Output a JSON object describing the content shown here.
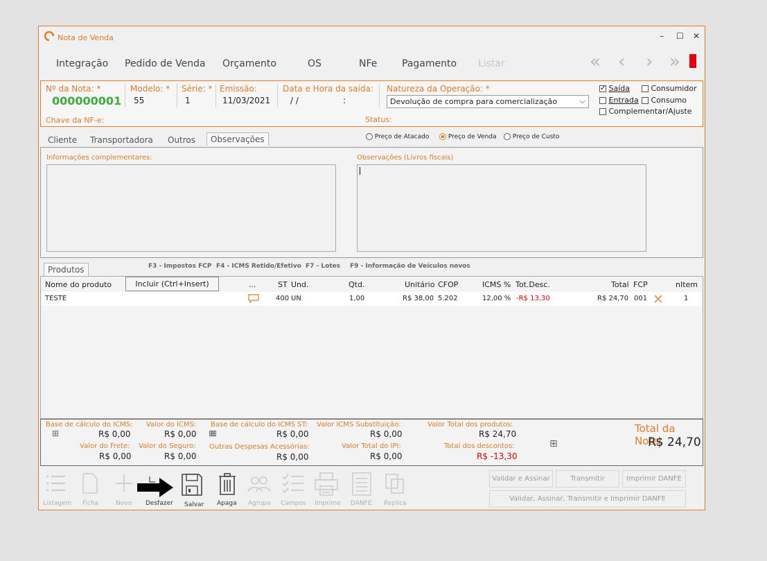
{
  "window": {
    "title": "Nota de Venda",
    "controls": [
      "–",
      "☐",
      "✕"
    ]
  },
  "menu": {
    "items": [
      "Integração",
      "Pedido de Venda",
      "Orçamento",
      "OS",
      "NFe",
      "Pagamento"
    ],
    "disabled_item": "Listar"
  },
  "nav": {
    "first": "«",
    "prev": "‹",
    "next": "›",
    "last": "»"
  },
  "header": {
    "nota_label": "Nº da Nota: *",
    "nota_value": "000000001",
    "modelo_label": "Modelo: *",
    "modelo_value": "55",
    "serie_label": "Série: *",
    "serie_value": "1",
    "emissao_label": "Emissão:",
    "emissao_value": "11/03/2021",
    "saida_label": "Data e Hora da saída:",
    "saida_value": "/  /",
    "saida_time": ":",
    "natureza_label": "Natureza da Operação: *",
    "natureza_value": "Devolução de compra para comercialização",
    "chave_label": "Chave da NF-e:",
    "status_label": "Status:",
    "checkboxes": {
      "saida": "Saída",
      "entrada": "Entrada",
      "complementar": "Complementar/Ajuste",
      "consumidor": "Consumidor",
      "consumo": "Consumo"
    }
  },
  "tabs": [
    "Cliente",
    "Transportadora",
    "Outros",
    "Observações"
  ],
  "price_options": [
    "Preço de Atacado",
    "Preço de Venda",
    "Preço de Custo"
  ],
  "observacoes": {
    "info_label": "Informações complementares:",
    "obs_label": "Observações (Livros fiscais)"
  },
  "produtos": {
    "tab": "Produtos",
    "fkeys": [
      "F3 - Impostos FCP",
      "F4 - ICMS Retido/Efetivo",
      "F7 - Lotes",
      "F9 - Informação de Veículos novos"
    ],
    "incluir": "Incluir (Ctrl+Insert)",
    "columns": {
      "nome": "Nome do produto",
      "dots": "...",
      "st": "ST",
      "und": "Und.",
      "qtd": "Qtd.",
      "unitario": "Unitário",
      "cfop": "CFOP",
      "icms": "ICMS %",
      "totdesc": "Tot.Desc.",
      "total": "Total",
      "fcp": "FCP",
      "nitem": "nItem"
    },
    "rows": [
      {
        "nome": "TESTE",
        "st": "400",
        "und": "UN",
        "qtd": "1,00",
        "unitario": "R$ 38,00",
        "cfop": "5.202",
        "icms": "12,00 %",
        "totdesc": "-R$ 13,30",
        "total": "R$ 24,70",
        "fcp": "001",
        "nitem": "1"
      }
    ]
  },
  "totals": {
    "base_icms_label": "Base de cálculo do ICMS:",
    "base_icms_value": "R$ 0,00",
    "valor_icms_label": "Valor do ICMS:",
    "valor_icms_value": "R$ 0,00",
    "base_st_label": "Base de cálculo do ICMS ST:",
    "base_st_value": "R$ 0,00",
    "icms_sub_label": "Valor ICMS Substituição:",
    "icms_sub_value": "R$ 0,00",
    "total_prod_label": "Valor Total dos produtos:",
    "total_prod_value": "R$ 24,70",
    "frete_label": "Valor do Frete:",
    "frete_value": "R$ 0,00",
    "seguro_label": "Valor do Seguro:",
    "seguro_value": "R$ 0,00",
    "outras_label": "Outras Despesas Acessórias:",
    "outras_value": "R$ 0,00",
    "ipi_label": "Valor Total do IPI:",
    "ipi_value": "R$ 0,00",
    "descontos_label": "Total dos descontos:",
    "descontos_value": "R$ -13,30",
    "nota_label": "Total da Nota:",
    "nota_value": "R$ 24,70"
  },
  "toolbar": {
    "listagem": "Listagem",
    "ficha": "Ficha",
    "novo": "Novo",
    "desfazer": "Desfazer",
    "salvar": "Salvar",
    "apaga": "Apaga",
    "agrupa": "Agrupa",
    "campos": "Campos",
    "imprime": "Imprime",
    "danfe": "DANFE",
    "replica": "Replica"
  },
  "actions": {
    "validar": "Validar e Assinar",
    "transmitir": "Transmitir",
    "imprimir": "Imprimir DANFE",
    "todos": "Validar, Assinar, Transmitir e Imprimir DANFE"
  },
  "colors": {
    "accent": "#e07b28",
    "green": "#3cac3c",
    "red": "#e8000b"
  }
}
